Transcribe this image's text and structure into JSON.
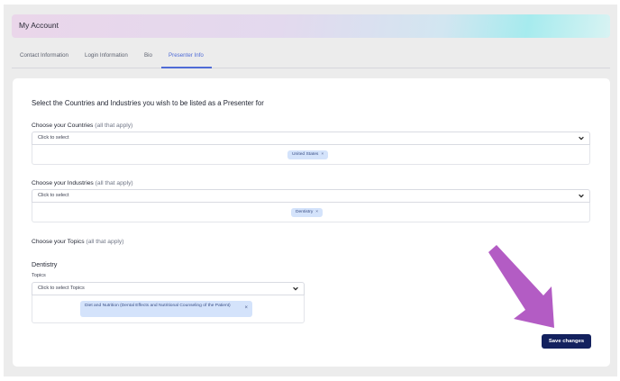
{
  "header": {
    "title": "My Account",
    "gradient_accent": "#a6ebee"
  },
  "tabs": [
    {
      "label": "Contact Information",
      "active": false
    },
    {
      "label": "Login Information",
      "active": false
    },
    {
      "label": "Bio",
      "active": false
    },
    {
      "label": "Presenter Info",
      "active": true
    }
  ],
  "accent_color": "#4f6bd6",
  "main": {
    "section_title": "Select the Countries and Industries you wish to be listed as a Presenter for",
    "countries": {
      "label": "Choose your Countries",
      "hint": "(all that apply)",
      "placeholder": "Click to select",
      "selected": [
        "United States"
      ]
    },
    "industries": {
      "label": "Choose your Industries",
      "hint": "(all that apply)",
      "placeholder": "Click to select",
      "selected": [
        "Dentistry"
      ]
    },
    "topics": {
      "label": "Choose your Topics",
      "hint": "(all that apply)",
      "group_heading": "Dentistry",
      "group_label": "Topics",
      "placeholder": "Click to select Topics",
      "selected": [
        "Diet and Nutrition (Dental Effects and Nutritional Counseling of the Patient)"
      ]
    },
    "chip_remove_glyph": "×",
    "save_label": "Save changes",
    "save_color": "#13215e"
  },
  "annotation": {
    "type": "arrow",
    "color": "#b35cc4",
    "icon": "pointer-arrow"
  }
}
